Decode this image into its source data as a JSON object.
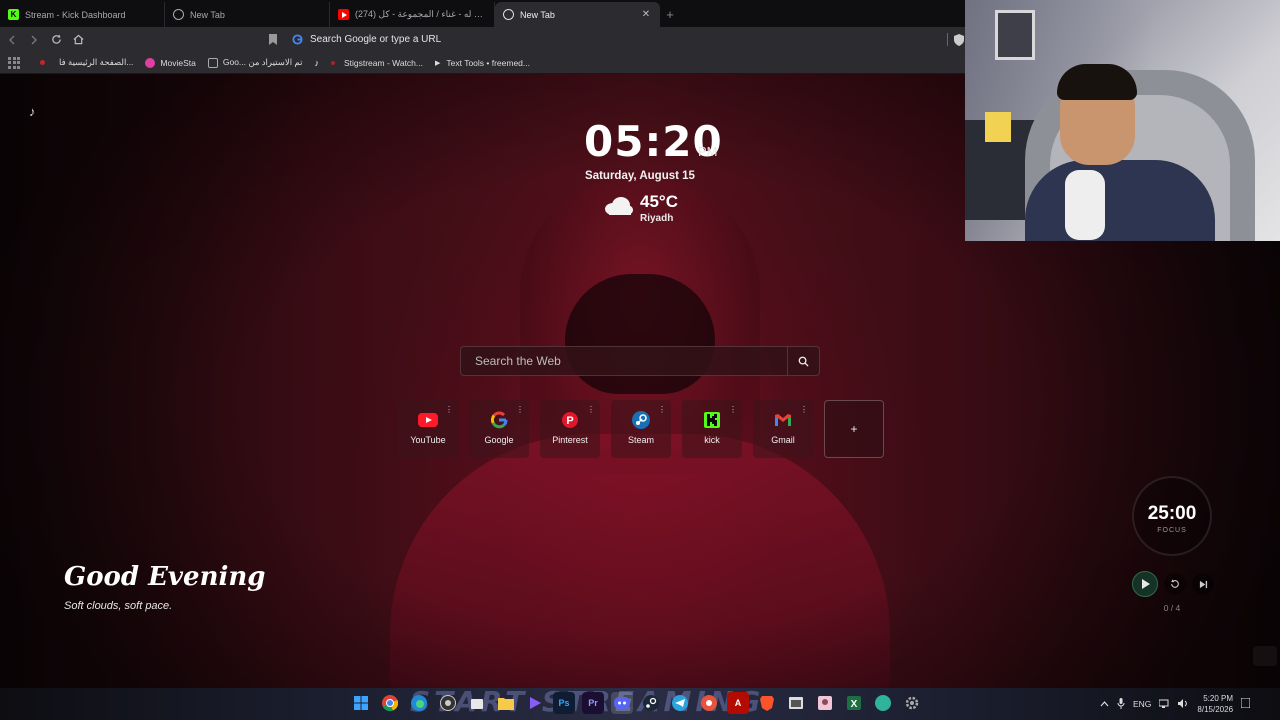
{
  "browser": {
    "tabs": [
      {
        "title": "Stream - Kick Dashboard",
        "favicon": "kick-logo-icon",
        "active": false
      },
      {
        "title": "New Tab",
        "favicon": "newtab-logo-icon",
        "active": false
      },
      {
        "title": "(274) شومي له - غناء / المجموعة - كل...",
        "favicon": "youtube-icon",
        "active": false
      },
      {
        "title": "New Tab",
        "favicon": "newtab-logo-icon",
        "active": true
      }
    ],
    "new_tab_symbol": "+",
    "close_symbol": "✕",
    "omnibox_placeholder": "Search Google or type a URL",
    "bookmarks": [
      {
        "label": "الصفحة الرئيسية فا...",
        "color": "#c4242b"
      },
      {
        "label": "MovieSta",
        "color": "#e23ea2"
      },
      {
        "label": "Goo... تم الاستيراد من",
        "color": "#8a8a8a"
      },
      {
        "label": "",
        "color": "#ffffff",
        "icon": "tiktok-icon"
      },
      {
        "label": "Stigstream - Watch...",
        "color": "#b01e2a"
      },
      {
        "label": "Text Tools • freemed...",
        "color": "#dddddd"
      }
    ]
  },
  "newtab": {
    "music_icon": "♪",
    "time": "05:20",
    "ampm": "PM",
    "date": "Saturday, August 15",
    "temperature": "45°C",
    "city": "Riyadh",
    "search_placeholder": "Search the Web",
    "shortcuts": [
      {
        "label": "YouTube",
        "icon": "youtube-icon",
        "color": "#ff1a2a"
      },
      {
        "label": "Google",
        "icon": "google-icon",
        "color": "#4285f4"
      },
      {
        "label": "Pinterest",
        "icon": "pinterest-icon",
        "color": "#e0162b"
      },
      {
        "label": "Steam",
        "icon": "steam-icon",
        "color": "#1b6fb5"
      },
      {
        "label": "kick",
        "icon": "kick-icon",
        "color": "#53fc18"
      },
      {
        "label": "Gmail",
        "icon": "gmail-icon",
        "color": "#ea4335"
      }
    ],
    "add_shortcut_symbol": "+",
    "greeting": "Good Evening",
    "subgreeting": "Soft clouds, soft pace."
  },
  "pomodoro": {
    "time": "25:00",
    "label": "FOCUS",
    "count": "0 / 4"
  },
  "taskbar": {
    "banner_text": "START STREAMING",
    "language": "ENG",
    "clock_time": "5:20 PM",
    "clock_date": "8/15/2026"
  },
  "colors": {
    "accent_red": "#7a1222",
    "background": "#0b0406",
    "pomodoro_play": "#2e6b4e"
  }
}
